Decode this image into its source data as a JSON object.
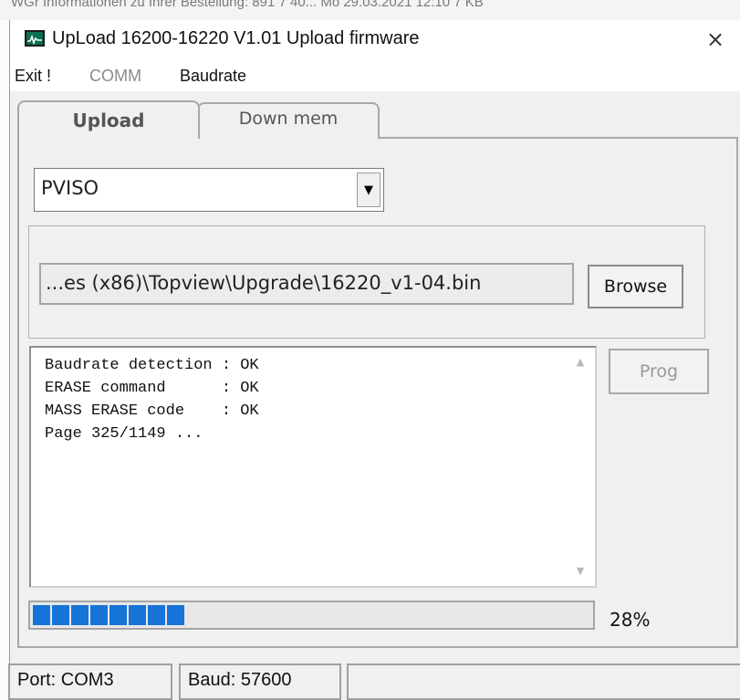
{
  "background_text": "WGr Informationen zu Ihrer Bestellung: 891 7 40... Mo 29.03.2021 12:10 7 KB",
  "window": {
    "title": "UpLoad 16200-16220  V1.01   Upload firmware",
    "close_symbol": "×"
  },
  "menu": [
    "Exit !",
    "COMM",
    "Baudrate"
  ],
  "tabs": [
    {
      "label": "Upload",
      "selected": true
    },
    {
      "label": "Down mem",
      "selected": false
    }
  ],
  "device_select": {
    "value": "PVISO",
    "arrow": "▼"
  },
  "file_path": "...es (x86)\\Topview\\Upgrade\\16220_v1-04.bin",
  "buttons": {
    "browse": "Browse",
    "prog": "Prog"
  },
  "log": {
    "lines": [
      "Baudrate detection : OK",
      "ERASE command      : OK",
      "MASS ERASE code    : OK",
      "Page 325/1149 ..."
    ],
    "scroll_up": "▲",
    "scroll_down": "▼"
  },
  "progress": {
    "percent_label": "28%",
    "fraction": 0.28,
    "color": "#1674d8"
  },
  "status": {
    "port": "Port: COM3",
    "baud": "Baud: 57600"
  }
}
